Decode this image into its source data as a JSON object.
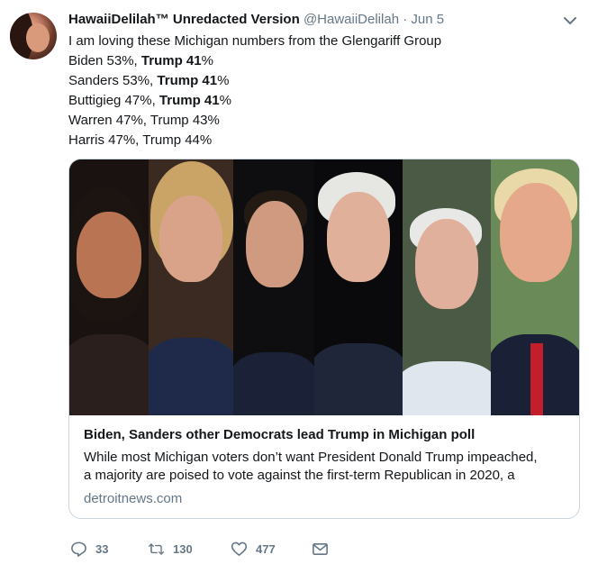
{
  "tweet": {
    "display_name": "HawaiiDelilah™ Unredacted Version",
    "handle": "@HawaiiDelilah",
    "separator": "·",
    "date": "Jun 5",
    "lines": [
      {
        "plain": "I am loving these Michigan numbers from the Glengariff Group",
        "bold": "",
        "tail": ""
      },
      {
        "plain": "Biden 53%, ",
        "bold": "Trump 41",
        "tail": "%"
      },
      {
        "plain": "Sanders 53%, ",
        "bold": "Trump 41",
        "tail": "%"
      },
      {
        "plain": "Buttigieg 47%, ",
        "bold": "Trump 41",
        "tail": "%"
      },
      {
        "plain": "Warren 47%, Trump 43%",
        "bold": "",
        "tail": ""
      },
      {
        "plain": "Harris 47%, Trump 44%",
        "bold": "",
        "tail": ""
      }
    ]
  },
  "card": {
    "title": "Biden, Sanders other Democrats lead Trump in Michigan poll",
    "description": "While most Michigan voters don’t want President Donald Trump impeached, a majority are poised to vote against the first-term Republican in 2020, a",
    "description_line1": "While most Michigan voters don’t want President Donald Trump impeached,",
    "description_line2": "a majority are poised to vote against the first-term Republican in 2020, a",
    "domain": "detroitnews.com"
  },
  "actions": {
    "reply_count": "33",
    "retweet_count": "130",
    "like_count": "477"
  },
  "icons": {
    "caret": "chevron-down-icon",
    "reply": "reply-icon",
    "retweet": "retweet-icon",
    "like": "heart-icon",
    "message": "envelope-icon"
  },
  "colors": {
    "text": "#14171a",
    "secondary": "#657786",
    "border": "#ccd6dd"
  }
}
